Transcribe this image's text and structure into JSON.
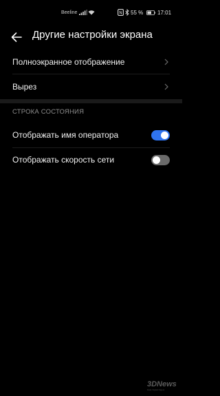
{
  "status_bar": {
    "carrier": "Beeline",
    "battery": "55 %",
    "time": "17:01",
    "icons": [
      "signal-icon",
      "wifi-icon",
      "nfc-icon",
      "bluetooth-icon",
      "battery-icon"
    ]
  },
  "header": {
    "back_icon": "back-arrow-icon",
    "title": "Другие настройки экрана"
  },
  "items": [
    {
      "label": "Полноэкранное отображение",
      "icon": "chevron-right-icon"
    },
    {
      "label": "Вырез",
      "icon": "chevron-right-icon"
    }
  ],
  "section": {
    "title": "СТРОКА СОСТОЯНИЯ",
    "toggles": [
      {
        "label": "Отображать имя оператора",
        "on": true
      },
      {
        "label": "Отображать скорость сети",
        "on": false
      }
    ]
  },
  "watermark": {
    "logo": "3DNews",
    "tagline": "Daily Digital Digest"
  },
  "colors": {
    "background": "#000000",
    "accent": "#2f74f0",
    "toggle_off": "#6a6a6a",
    "section_title": "#8d8d8d"
  }
}
